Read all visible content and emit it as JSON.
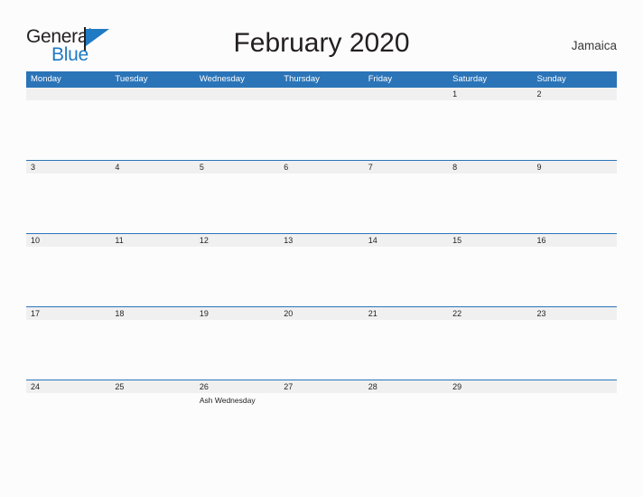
{
  "brand": {
    "name_part1": "General",
    "name_part2": "Blue",
    "flag_icon": "blue-flag-triangle",
    "accent_color": "#1f7ac4"
  },
  "header": {
    "title": "February 2020",
    "country": "Jamaica"
  },
  "calendar": {
    "header_color": "#2b74b8",
    "band_color": "#f0f0f0",
    "weekdays": [
      "Monday",
      "Tuesday",
      "Wednesday",
      "Thursday",
      "Friday",
      "Saturday",
      "Sunday"
    ],
    "weeks": [
      [
        {
          "day": ""
        },
        {
          "day": ""
        },
        {
          "day": ""
        },
        {
          "day": ""
        },
        {
          "day": ""
        },
        {
          "day": "1"
        },
        {
          "day": "2"
        }
      ],
      [
        {
          "day": "3"
        },
        {
          "day": "4"
        },
        {
          "day": "5"
        },
        {
          "day": "6"
        },
        {
          "day": "7"
        },
        {
          "day": "8"
        },
        {
          "day": "9"
        }
      ],
      [
        {
          "day": "10"
        },
        {
          "day": "11"
        },
        {
          "day": "12"
        },
        {
          "day": "13"
        },
        {
          "day": "14"
        },
        {
          "day": "15"
        },
        {
          "day": "16"
        }
      ],
      [
        {
          "day": "17"
        },
        {
          "day": "18"
        },
        {
          "day": "19"
        },
        {
          "day": "20"
        },
        {
          "day": "21"
        },
        {
          "day": "22"
        },
        {
          "day": "23"
        }
      ],
      [
        {
          "day": "24"
        },
        {
          "day": "25"
        },
        {
          "day": "26",
          "event": "Ash Wednesday"
        },
        {
          "day": "27"
        },
        {
          "day": "28"
        },
        {
          "day": "29"
        },
        {
          "day": ""
        }
      ]
    ]
  }
}
